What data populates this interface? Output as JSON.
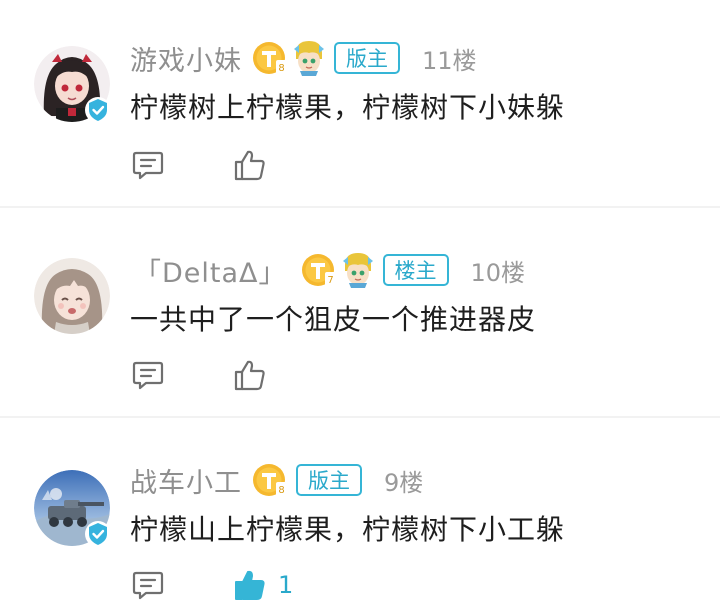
{
  "comments": [
    {
      "username": "游戏小妹",
      "role": "版主",
      "floor": "11楼",
      "level": "8",
      "text": "柠檬树上柠檬果，柠檬树下小妹躲",
      "likes": "",
      "liked": false,
      "verified": true,
      "medal": true
    },
    {
      "username": "「DeltaΔ」",
      "role": "楼主",
      "floor": "10楼",
      "level": "7",
      "text": "一共中了一个狙皮一个推进器皮",
      "likes": "",
      "liked": false,
      "verified": false,
      "medal": true
    },
    {
      "username": "战车小工",
      "role": "版主",
      "floor": "9楼",
      "level": "8",
      "text": "柠檬山上柠檬果，柠檬树下小工躲",
      "likes": "1",
      "liked": true,
      "verified": true,
      "medal": false
    }
  ],
  "icons": {
    "reply": "comment-bubble-icon",
    "like": "thumbs-up-icon",
    "verified": "verified-check-icon",
    "level": "level-coin-icon",
    "medal": "character-medal-icon"
  },
  "colors": {
    "accent": "#2aa9cb",
    "username": "#8f8f8f",
    "text": "#1e1e1e",
    "coin": "#f5b82e"
  }
}
